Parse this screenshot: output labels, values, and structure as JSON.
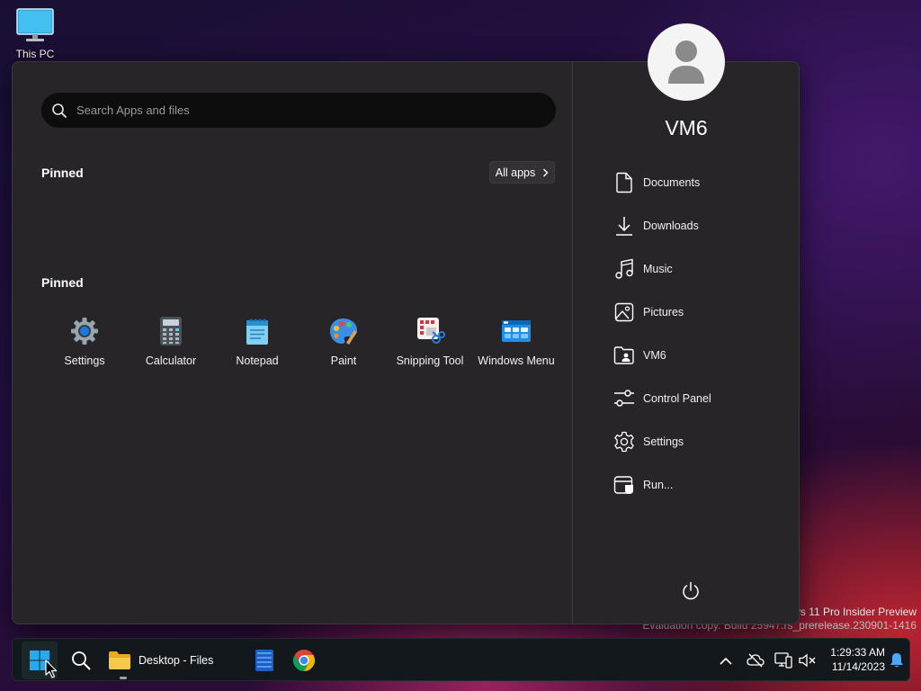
{
  "desktop": {
    "icons": [
      {
        "label": "This PC",
        "icon": "monitor-icon"
      }
    ]
  },
  "watermark": {
    "line1": "ws 11 Pro Insider Preview",
    "line2": "Evaluation copy. Build 25947.rs_prerelease.230901-1416"
  },
  "start_menu": {
    "search": {
      "placeholder": "Search Apps and files",
      "value": ""
    },
    "section1": {
      "title": "Pinned",
      "all_apps_label": "All apps"
    },
    "section2": {
      "title": "Pinned",
      "apps": [
        {
          "label": "Settings",
          "icon": "settings-gear-icon"
        },
        {
          "label": "Calculator",
          "icon": "calculator-icon"
        },
        {
          "label": "Notepad",
          "icon": "notepad-icon"
        },
        {
          "label": "Paint",
          "icon": "paint-palette-icon"
        },
        {
          "label": "Snipping Tool",
          "icon": "snipping-tool-icon"
        },
        {
          "label": "Windows Menu",
          "icon": "windows-menu-icon"
        }
      ]
    },
    "user": {
      "name": "VM6"
    },
    "places": [
      {
        "label": "Documents",
        "icon": "document-icon"
      },
      {
        "label": "Downloads",
        "icon": "download-icon"
      },
      {
        "label": "Music",
        "icon": "music-icon"
      },
      {
        "label": "Pictures",
        "icon": "pictures-icon"
      },
      {
        "label": "VM6",
        "icon": "user-folder-icon"
      },
      {
        "label": "Control Panel",
        "icon": "control-panel-icon"
      },
      {
        "label": "Settings",
        "icon": "gear-icon"
      },
      {
        "label": "Run...",
        "icon": "run-icon"
      }
    ]
  },
  "taskbar": {
    "files_label": "Desktop - Files",
    "time": "1:29:33 AM",
    "date": "11/14/2023"
  }
}
